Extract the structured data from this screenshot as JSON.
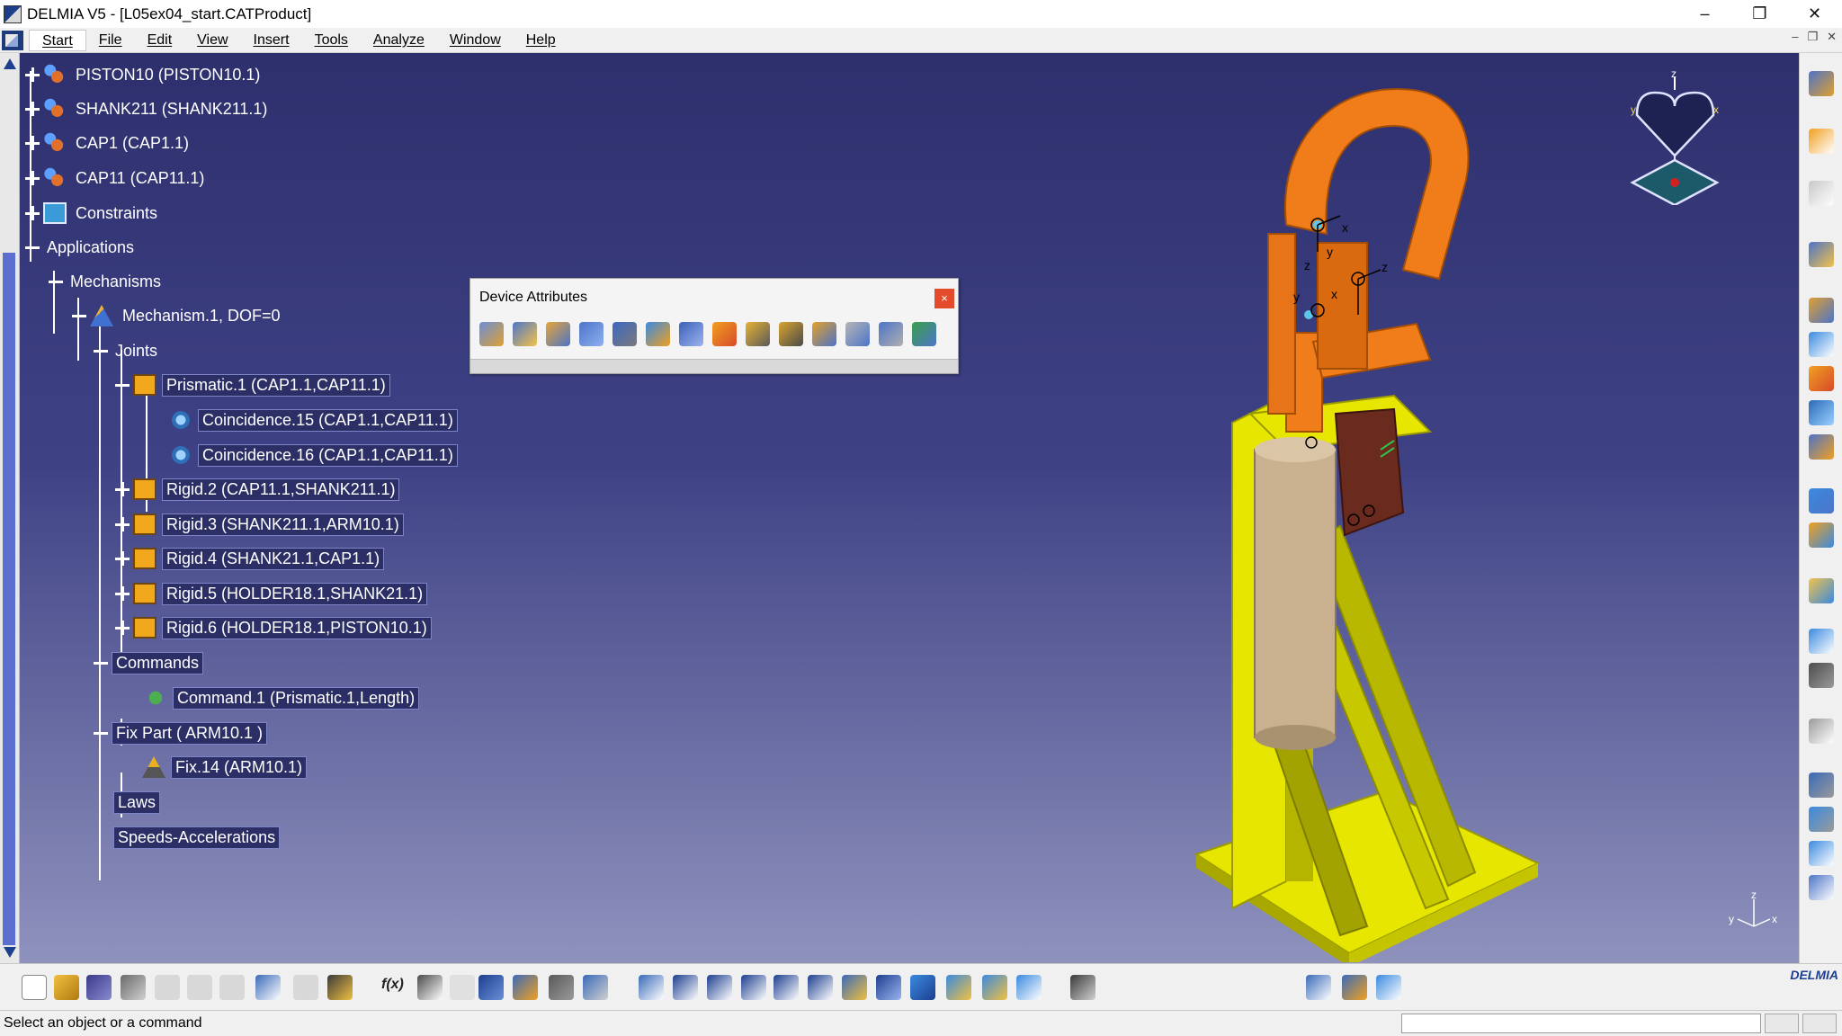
{
  "window": {
    "title": "DELMIA V5 - [L05ex04_start.CATProduct]",
    "minimize": "–",
    "restore": "❐",
    "close": "✕"
  },
  "menu": {
    "items": [
      "Start",
      "File",
      "Edit",
      "View",
      "Insert",
      "Tools",
      "Analyze",
      "Window",
      "Help"
    ]
  },
  "tree": {
    "piston": "PISTON10 (PISTON10.1)",
    "shank": "SHANK211 (SHANK211.1)",
    "cap1": "CAP1 (CAP1.1)",
    "cap11": "CAP11 (CAP11.1)",
    "constraints": "Constraints",
    "applications": "Applications",
    "mechanisms": "Mechanisms",
    "mechanism1": "Mechanism.1, DOF=0",
    "joints": "Joints",
    "prismatic1": "Prismatic.1 (CAP1.1,CAP11.1)",
    "coincidence15": "Coincidence.15 (CAP1.1,CAP11.1)",
    "coincidence16": "Coincidence.16 (CAP1.1,CAP11.1)",
    "rigid2": "Rigid.2 (CAP11.1,SHANK211.1)",
    "rigid3": "Rigid.3 (SHANK211.1,ARM10.1)",
    "rigid4": "Rigid.4 (SHANK21.1,CAP1.1)",
    "rigid5": "Rigid.5 (HOLDER18.1,SHANK21.1)",
    "rigid6": "Rigid.6 (HOLDER18.1,PISTON10.1)",
    "commands": "Commands",
    "command1": "Command.1 (Prismatic.1,Length)",
    "fixpart": "Fix Part ( ARM10.1 )",
    "fix14": "Fix.14 (ARM10.1)",
    "laws": "Laws",
    "speeds": "Speeds-Accelerations"
  },
  "device_attributes": {
    "title": "Device Attributes",
    "close": "×",
    "icons": [
      "device-tool-icon",
      "home-position-icon",
      "travel-limits-icon",
      "dof-icon",
      "device-link-icon",
      "joint-speed-icon",
      "kinematic-solver-icon",
      "inverse-kinematics-icon",
      "turn-icon",
      "tool-tip-icon",
      "base-icon",
      "jog-icon",
      "teach-icon",
      "refresh-icon"
    ]
  },
  "compass": {
    "z_label": "z",
    "x_label": "x",
    "y_label": "y"
  },
  "axis_triad": {
    "z": "z",
    "x": "x",
    "y": "y"
  },
  "model_labels": {
    "x1": "x",
    "y1": "y",
    "z1": "z",
    "x2": "x",
    "y2": "y",
    "z2": "z"
  },
  "bottom_toolbar": {
    "logo": "DELMIA",
    "fx_label": "f(x)"
  },
  "status": {
    "text": "Select an object or a command",
    "input_value": ""
  },
  "colors": {
    "viewport_top": "#2e2f6d",
    "viewport_bottom": "#8f92bd",
    "model_yellow": "#e6e600",
    "model_orange": "#f07d1a",
    "model_tan": "#c9b18f",
    "model_brown": "#6b2a1e"
  }
}
